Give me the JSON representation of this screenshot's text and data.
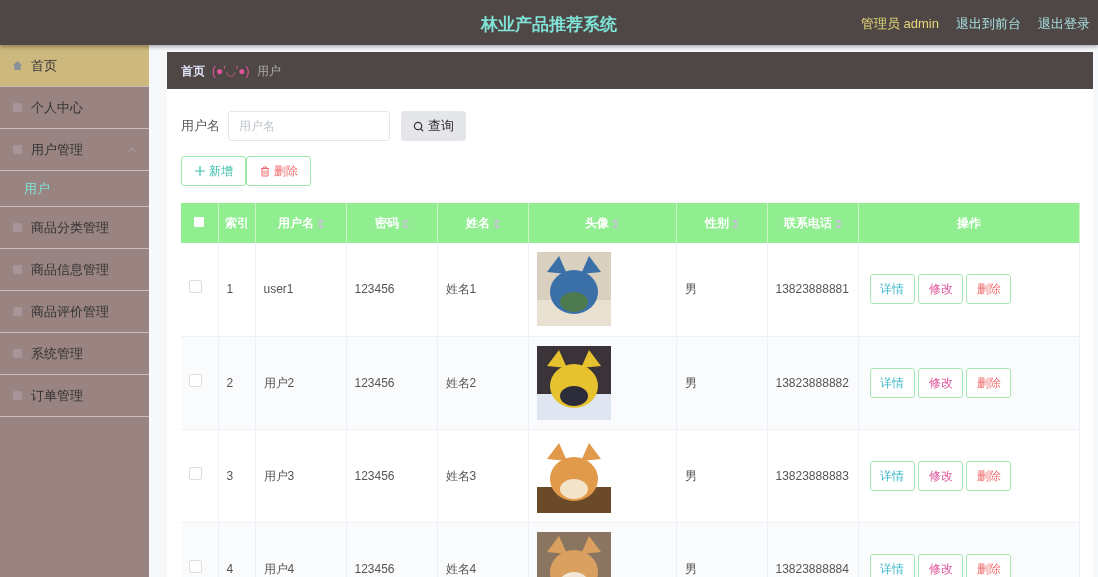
{
  "header": {
    "title": "林业产品推荐系统",
    "user": "管理员 admin",
    "links": [
      "退出到前台",
      "退出登录"
    ]
  },
  "sidebar": {
    "items": [
      {
        "label": "首页",
        "selected": true
      },
      {
        "label": "个人中心",
        "selected": false
      },
      {
        "label": "用户管理",
        "selected": false,
        "expanded": true,
        "children": [
          {
            "label": "用户",
            "selected": true
          }
        ]
      },
      {
        "label": "商品分类管理",
        "selected": false
      },
      {
        "label": "商品信息管理",
        "selected": false
      },
      {
        "label": "商品评价管理",
        "selected": false
      },
      {
        "label": "系统管理",
        "selected": false
      },
      {
        "label": "订单管理",
        "selected": false
      }
    ]
  },
  "breadcrumb": {
    "home": "首页",
    "separator": "(●'◡'●)",
    "current": "用户"
  },
  "search": {
    "label": "用户名",
    "placeholder": "用户名",
    "button": "查询"
  },
  "actions": {
    "add": "新增",
    "delete": "删除"
  },
  "table": {
    "header_checked": false,
    "columns": [
      {
        "label": "索引",
        "sortable": false
      },
      {
        "label": "用户名",
        "sortable": true
      },
      {
        "label": "密码",
        "sortable": true
      },
      {
        "label": "姓名",
        "sortable": true
      },
      {
        "label": "头像",
        "sortable": true
      },
      {
        "label": "性别",
        "sortable": true
      },
      {
        "label": "联系电话",
        "sortable": true
      },
      {
        "label": "操作",
        "sortable": false
      }
    ],
    "rows": [
      {
        "checked": false,
        "index": "1",
        "username": "user1",
        "password": "123456",
        "name": "姓名1",
        "avatar": {
          "kind": "picture"
        },
        "gender": "男",
        "phone": "13823888881",
        "buttons": [
          "详情",
          "修改",
          "删除"
        ]
      },
      {
        "checked": false,
        "index": "2",
        "username": "用户2",
        "password": "123456",
        "name": "姓名2",
        "avatar": {
          "kind": "picture"
        },
        "gender": "男",
        "phone": "13823888882",
        "buttons": [
          "详情",
          "修改",
          "删除"
        ]
      },
      {
        "checked": false,
        "index": "3",
        "username": "用户3",
        "password": "123456",
        "name": "姓名3",
        "avatar": {
          "kind": "picture"
        },
        "gender": "男",
        "phone": "13823888883",
        "buttons": [
          "详情",
          "修改",
          "删除"
        ]
      },
      {
        "checked": false,
        "index": "4",
        "username": "用户4",
        "password": "123456",
        "name": "姓名4",
        "avatar": {
          "kind": "picture"
        },
        "gender": "男",
        "phone": "13823888884",
        "buttons": [
          "详情",
          "修改",
          "删除"
        ]
      }
    ]
  }
}
